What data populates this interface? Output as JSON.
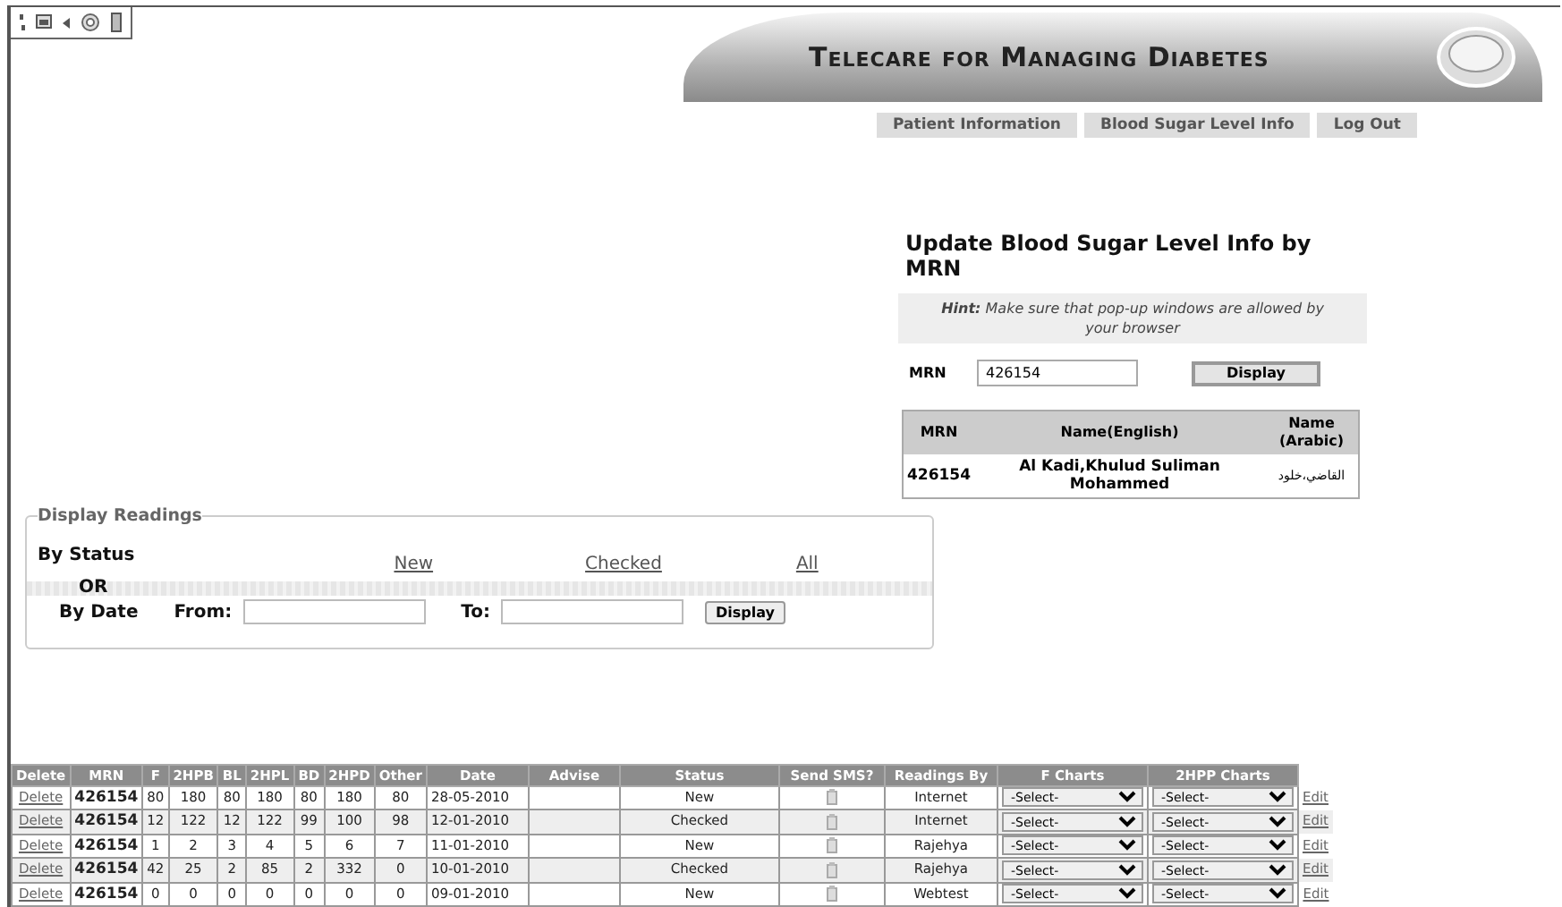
{
  "header": {
    "title": "Telecare for Managing Diabetes"
  },
  "nav": [
    {
      "label": "Patient Information"
    },
    {
      "label": "Blood Sugar Level Info"
    },
    {
      "label": "Log Out"
    }
  ],
  "update": {
    "title": "Update Blood Sugar Level Info by MRN",
    "hint": "**Hint:** Make sure that pop-up windows are allowed by your browser",
    "mrn_label": "MRN",
    "mrn_value": "426154",
    "button": "Display",
    "patient_table": {
      "columns": [
        "MRN",
        "Name(English)",
        "Name (Arabic)"
      ],
      "rows": [
        [
          "426154",
          "Al Kadi,Khulud Suliman Mohammed",
          "القاضي،خلود"
        ]
      ]
    }
  },
  "readings": {
    "legend": "Display Readings",
    "by_status": "By Status",
    "status_links": [
      "New",
      "Checked",
      "All"
    ],
    "or": "OR",
    "by_date": "By Date",
    "from_label": "From:",
    "to_label": "To:",
    "button": "Display"
  },
  "table": {
    "columns": [
      "Delete",
      "MRN",
      "F",
      "2HPB",
      "BL",
      "2HPL",
      "BD",
      "2HPD",
      "Other",
      "Date",
      "Advise",
      "Status",
      "Send SMS?",
      "Readings By",
      "F Charts",
      "2HPP Charts"
    ],
    "rows": [
      {
        "delete": "Delete",
        "mrn": "426154",
        "values": [
          "80",
          "180",
          "80",
          "180",
          "80",
          "180",
          "80"
        ],
        "date": "28-05-2010",
        "status": "New",
        "readings_by": "Internet",
        "f_chart": "-Select-",
        "hpp_chart": "-Select-",
        "edit": "Edit"
      },
      {
        "delete": "Delete",
        "mrn": "426154",
        "values": [
          "12",
          "122",
          "12",
          "122",
          "99",
          "100",
          "98"
        ],
        "date": "12-01-2010",
        "status": "Checked",
        "readings_by": "Internet",
        "f_chart": "-Select-",
        "hpp_chart": "-Select-",
        "edit": "Edit"
      },
      {
        "delete": "Delete",
        "mrn": "426154",
        "values": [
          "1",
          "2",
          "3",
          "4",
          "5",
          "6",
          "7"
        ],
        "date": "11-01-2010",
        "status": "New",
        "readings_by": "Rajehya",
        "f_chart": "-Select-",
        "hpp_chart": "-Select-",
        "edit": "Edit"
      },
      {
        "delete": "Delete",
        "mrn": "426154",
        "values": [
          "42",
          "25",
          "2",
          "85",
          "2",
          "332",
          "0"
        ],
        "date": "10-01-2010",
        "status": "Checked",
        "readings_by": "Rajehya",
        "f_chart": "-Select-",
        "hpp_chart": "-Select-",
        "edit": "Edit"
      },
      {
        "delete": "Delete",
        "mrn": "426154",
        "values": [
          "0",
          "0",
          "0",
          "0",
          "0",
          "0",
          "0"
        ],
        "date": "09-01-2010",
        "status": "New",
        "readings_by": "Webtest",
        "f_chart": "-Select-",
        "hpp_chart": "-Select-",
        "edit": "Edit"
      }
    ]
  }
}
